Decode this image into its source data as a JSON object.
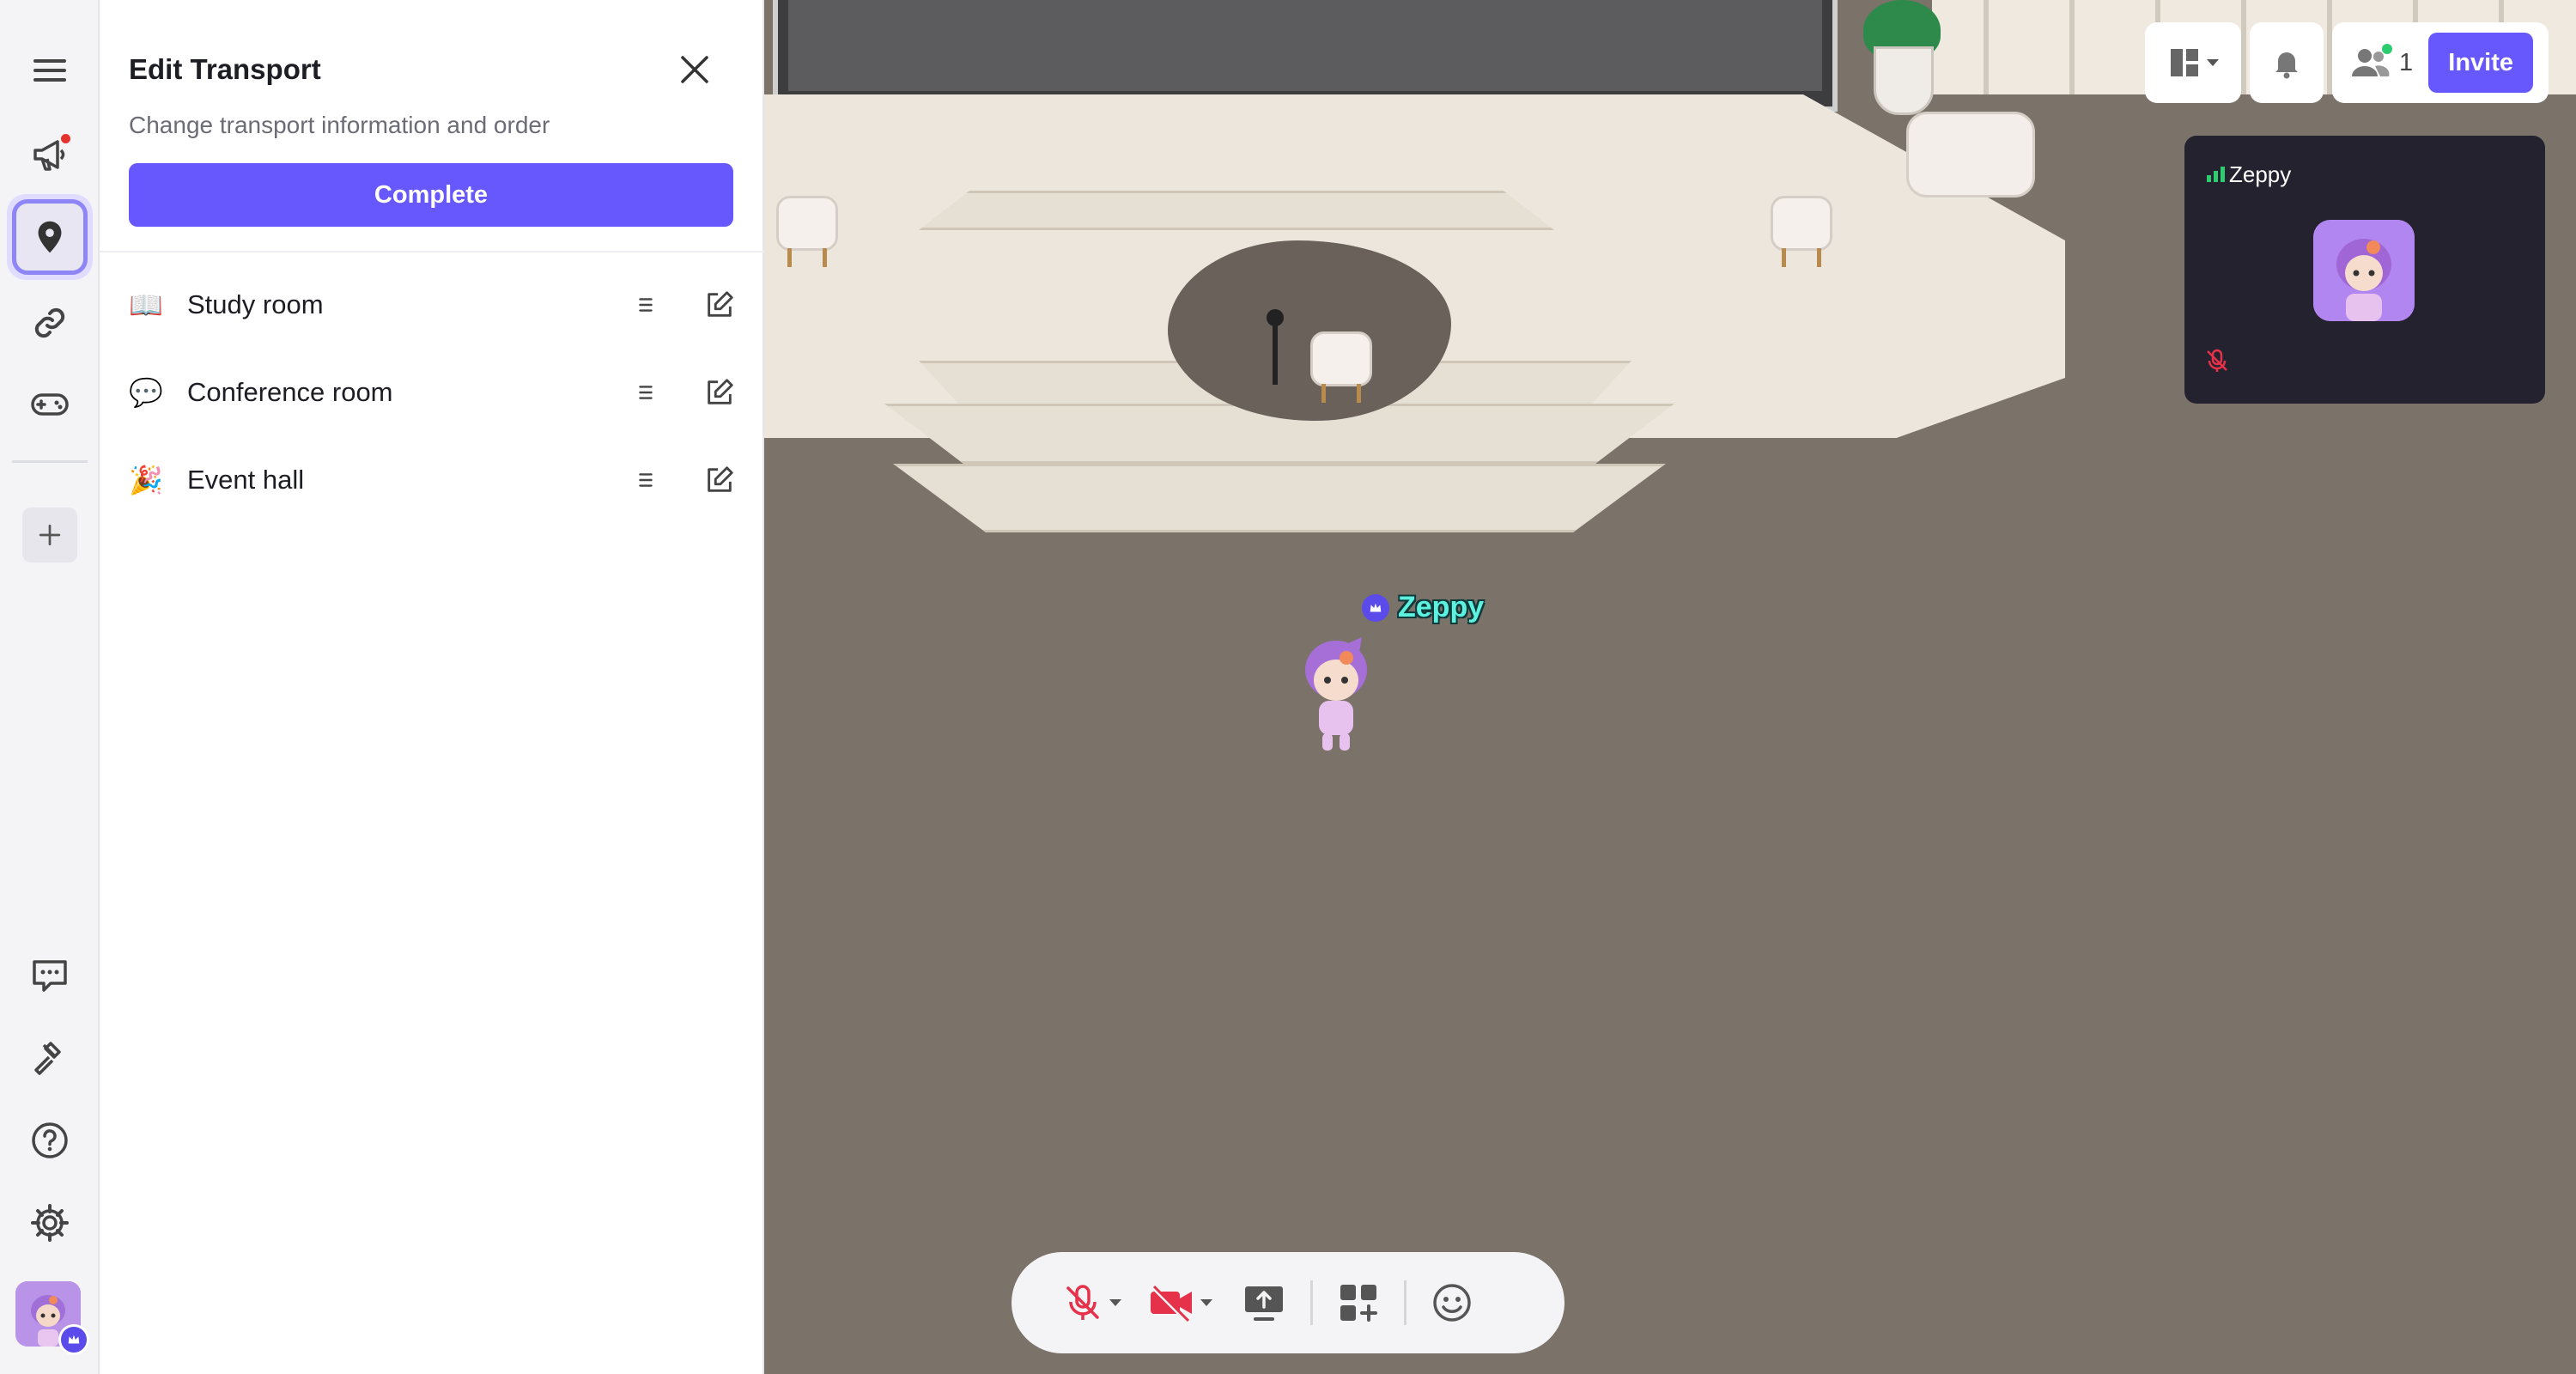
{
  "panel": {
    "title": "Edit Transport",
    "subtitle": "Change transport information and order",
    "complete_label": "Complete",
    "rooms": [
      {
        "emoji": "📖",
        "label": "Study room"
      },
      {
        "emoji": "💬",
        "label": "Conference room"
      },
      {
        "emoji": "🎉",
        "label": "Event hall"
      }
    ]
  },
  "top_bar": {
    "participant_count": "1",
    "invite_label": "Invite"
  },
  "video_tile": {
    "name": "Zeppy"
  },
  "player": {
    "name": "Zeppy"
  },
  "colors": {
    "accent": "#6758fe",
    "player_name": "#5df2e0",
    "mute_red": "#e5324a"
  }
}
